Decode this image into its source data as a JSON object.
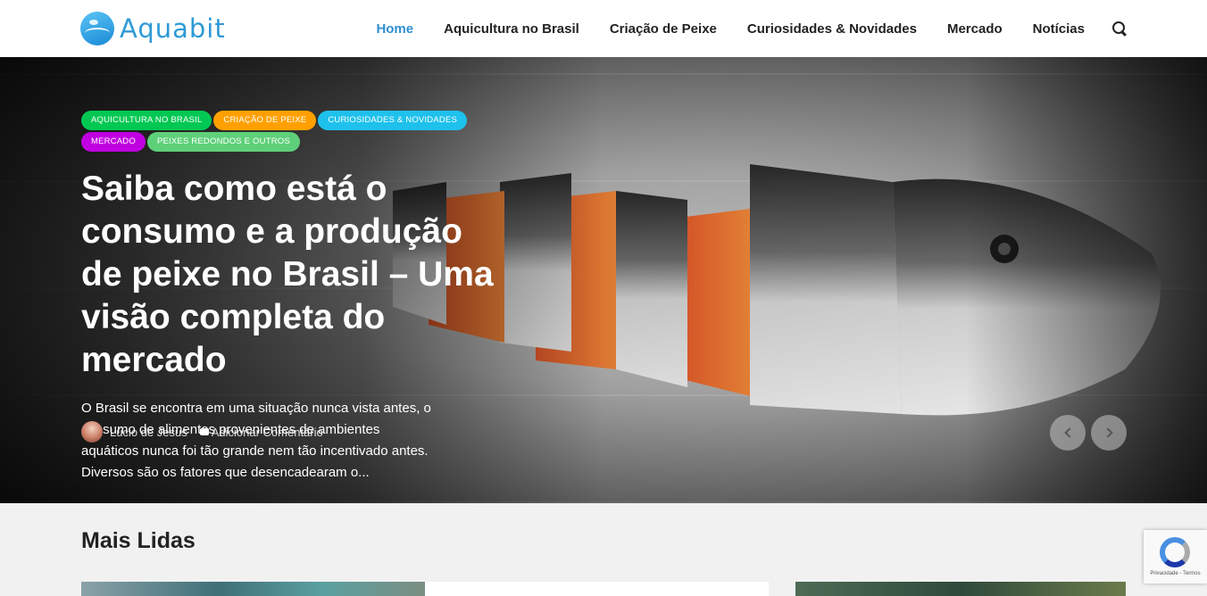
{
  "brand": {
    "name": "Aquabit"
  },
  "nav": {
    "items": [
      {
        "label": "Home",
        "active": true
      },
      {
        "label": "Aquicultura no Brasil",
        "active": false
      },
      {
        "label": "Criação de Peixe",
        "active": false
      },
      {
        "label": "Curiosidades & Novidades",
        "active": false
      },
      {
        "label": "Mercado",
        "active": false
      },
      {
        "label": "Notícias",
        "active": false
      }
    ],
    "search_icon": "search-icon"
  },
  "hero": {
    "tags": [
      {
        "label": "Aquicultura no Brasil",
        "color": "#00c853"
      },
      {
        "label": "Criação de Peixe",
        "color": "#ffa000"
      },
      {
        "label": "Curiosidades & Novidades",
        "color": "#1ec1ec"
      },
      {
        "label": "Mercado",
        "color": "#c000e0"
      },
      {
        "label": "Peixes redondos e outros",
        "color": "#5fd07a"
      }
    ],
    "title": "Saiba como está o consumo e a produção de peixe no Brasil – Uma visão completa do mercado",
    "excerpt": "O Brasil se encontra em uma situação nunca vista antes, o consumo de alimentos provenientes de ambientes aquáticos nunca foi tão grande nem tão incentivado antes. Diversos são os fatores que desencadearam o...",
    "author": "Lúcio de Jesus",
    "comments": "Adicionar Comentário"
  },
  "section": {
    "title": "Mais Lidas"
  },
  "recaptcha": {
    "text": "Privacidade - Termos"
  },
  "colors": {
    "accent": "#2f8fd1",
    "brand": "#2f9ad6"
  }
}
